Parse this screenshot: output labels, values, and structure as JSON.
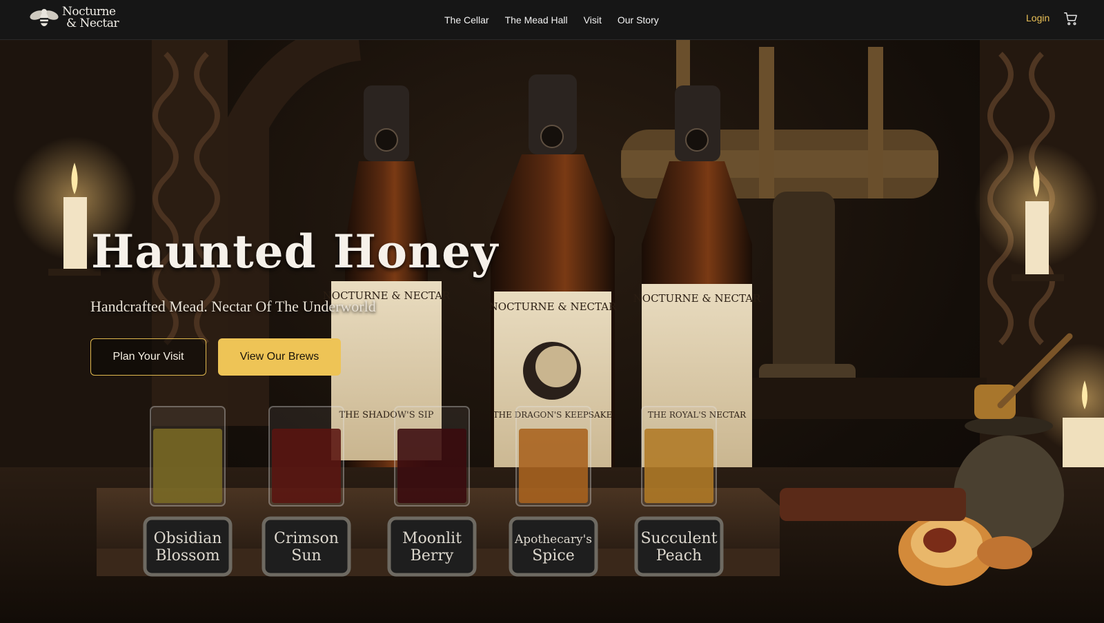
{
  "brand": {
    "line1": "Nocturne",
    "line2": "& Nectar",
    "logo_icon": "bee-icon"
  },
  "nav": {
    "links": [
      {
        "label": "The Cellar"
      },
      {
        "label": "The Mead Hall"
      },
      {
        "label": "Visit"
      },
      {
        "label": "Our Story"
      }
    ],
    "login_label": "Login",
    "cart_icon": "cart-icon"
  },
  "hero": {
    "title": "Haunted Honey",
    "subtitle": "Handcrafted Mead. Nectar Of The Underworld",
    "primary_button": "Plan Your Visit",
    "secondary_button": "View Our Brews",
    "bottles": [
      {
        "brand": "NOCTURNE & NECTAR",
        "name": "THE SHADOW'S SIP"
      },
      {
        "brand": "NOCTURNE & NECTAR",
        "name": "THE DRAGON'S KEEPSAKE"
      },
      {
        "brand": "NOCTURNE & NECTAR",
        "name": "THE ROYAL'S NECTAR"
      }
    ],
    "flight": [
      {
        "line1": "Obsidian",
        "line2": "Blossom",
        "color": "#7a6a24"
      },
      {
        "line1": "Crimson",
        "line2": "Sun",
        "color": "#5a1410"
      },
      {
        "line1": "Moonlit",
        "line2": "Berry",
        "color": "#3a0a0e"
      },
      {
        "line1": "Apothecary's",
        "line2": "Spice",
        "color": "#a8621e"
      },
      {
        "line1": "Succulent",
        "line2": "Peach",
        "color": "#b07a26"
      }
    ]
  },
  "colors": {
    "accent": "#eec456",
    "nav_bg": "#161616"
  }
}
